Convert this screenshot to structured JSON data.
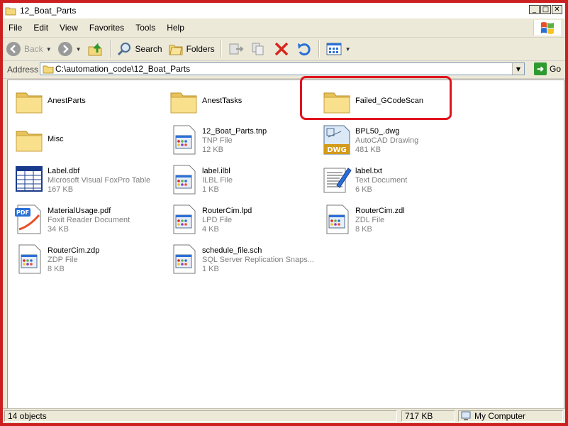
{
  "window": {
    "title": "12_Boat_Parts",
    "minimize_glyph": "_",
    "maximize_glyph": "□",
    "close_glyph": "✕"
  },
  "menu": {
    "items": [
      "File",
      "Edit",
      "View",
      "Favorites",
      "Tools",
      "Help"
    ]
  },
  "toolbar": {
    "back_label": "Back",
    "search_label": "Search",
    "folders_label": "Folders"
  },
  "address": {
    "label": "Address",
    "path": "C:\\automation_code\\12_Boat_Parts",
    "go_label": "Go"
  },
  "files": [
    {
      "name": "AnestParts",
      "type": "",
      "size": "",
      "icon": "folder-icon"
    },
    {
      "name": "AnestTasks",
      "type": "",
      "size": "",
      "icon": "folder-icon"
    },
    {
      "name": "Failed_GCodeScan",
      "type": "",
      "size": "",
      "icon": "folder-icon"
    },
    {
      "name": "Misc",
      "type": "",
      "size": "",
      "icon": "folder-icon"
    },
    {
      "name": "12_Boat_Parts.tnp",
      "type": "TNP File",
      "size": "12 KB",
      "icon": "generic-file-icon"
    },
    {
      "name": "BPL50_.dwg",
      "type": "AutoCAD Drawing",
      "size": "481 KB",
      "icon": "dwg-file-icon"
    },
    {
      "name": "Label.dbf",
      "type": "Microsoft Visual FoxPro Table",
      "size": "167 KB",
      "icon": "table-file-icon"
    },
    {
      "name": "label.ilbl",
      "type": "ILBL File",
      "size": "1 KB",
      "icon": "generic-file-icon"
    },
    {
      "name": "label.txt",
      "type": "Text Document",
      "size": "6 KB",
      "icon": "text-file-icon"
    },
    {
      "name": "MaterialUsage.pdf",
      "type": "Foxit Reader Document",
      "size": "34 KB",
      "icon": "pdf-file-icon"
    },
    {
      "name": "RouterCim.lpd",
      "type": "LPD File",
      "size": "4 KB",
      "icon": "generic-file-icon"
    },
    {
      "name": "RouterCim.zdl",
      "type": "ZDL File",
      "size": "8 KB",
      "icon": "generic-file-icon"
    },
    {
      "name": "RouterCim.zdp",
      "type": "ZDP File",
      "size": "8 KB",
      "icon": "generic-file-icon"
    },
    {
      "name": "schedule_file.sch",
      "type": "SQL Server Replication Snaps...",
      "size": "1 KB",
      "icon": "generic-file-icon"
    }
  ],
  "status": {
    "objects": "14 objects",
    "size": "717 KB",
    "location": "My Computer"
  },
  "colors": {
    "window_border": "#cc1f1f",
    "highlight": "#e0141e",
    "folder": "#f4d87a"
  }
}
